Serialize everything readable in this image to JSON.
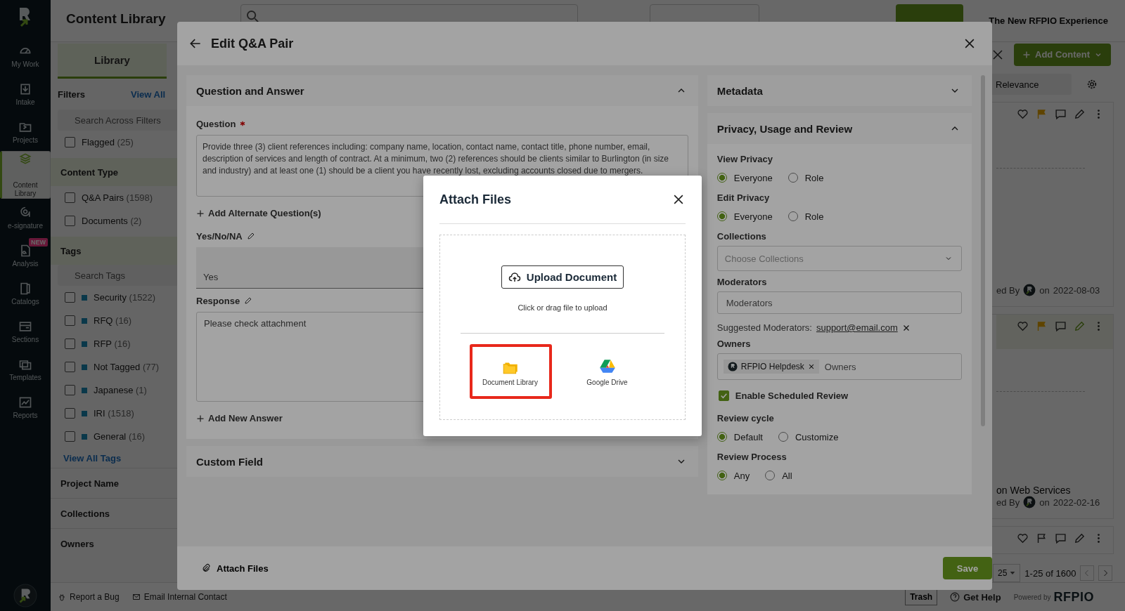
{
  "nav": {
    "items": [
      {
        "label": "My Work",
        "selected": false
      },
      {
        "label": "Intake",
        "selected": false
      },
      {
        "label": "Projects",
        "selected": false
      },
      {
        "label": "Content Library",
        "selected": true
      },
      {
        "label": "e-signature",
        "selected": false
      },
      {
        "label": "Analysis",
        "selected": false,
        "badge": "NEW"
      },
      {
        "label": "Catalogs",
        "selected": false
      },
      {
        "label": "Sections",
        "selected": false
      },
      {
        "label": "Templates",
        "selected": false
      },
      {
        "label": "Reports",
        "selected": false
      }
    ]
  },
  "page": {
    "title": "Content Library",
    "experience_menu": "The New RFPIO Experience",
    "add_content_button": "Add Content"
  },
  "filters": {
    "tab": "Library",
    "title": "Filters",
    "view_all": "View All",
    "search": {
      "placeholder": "Search Across Filters"
    },
    "flagged": {
      "label": "Flagged",
      "count": "(25)",
      "checked": false
    },
    "content_type": {
      "title": "Content Type",
      "items": [
        {
          "label": "Q&A Pairs",
          "count": "(1598)",
          "checked": false
        },
        {
          "label": "Documents",
          "count": "(2)",
          "checked": false
        }
      ]
    },
    "tags": {
      "title": "Tags",
      "search": {
        "placeholder": "Search Tags"
      },
      "items": [
        {
          "label": "Security",
          "count": "(1522)",
          "checked": false
        },
        {
          "label": "RFQ",
          "count": "(16)",
          "checked": false
        },
        {
          "label": "RFP",
          "count": "(16)",
          "checked": false
        },
        {
          "label": "Not Tagged",
          "count": "(77)",
          "checked": false
        },
        {
          "label": "Japanese",
          "count": "(1)",
          "checked": false
        },
        {
          "label": "IRI",
          "count": "(1518)",
          "checked": false
        },
        {
          "label": "General",
          "count": "(16)",
          "checked": false
        }
      ],
      "view_all": "View All Tags"
    },
    "collapsed_sections": [
      "Project Name",
      "Collections",
      "Owners"
    ]
  },
  "results": {
    "sort": "Relevance",
    "cards": [
      {
        "flagged": true,
        "highlighted": false,
        "author": "ed By",
        "on": "on",
        "date": "2022-08-03"
      },
      {
        "flagged": true,
        "highlighted": true,
        "snippet": "on Web Services",
        "author": "ed By",
        "on": "on",
        "date": "2022-02-16"
      },
      {
        "flagged": false,
        "highlighted": false
      }
    ],
    "page_size": "25",
    "range": "1-25 of 1600"
  },
  "footer": {
    "report_bug": "Report a Bug",
    "email_contact": "Email Internal Contact",
    "trash": "Trash",
    "get_help": "Get Help",
    "powered_by": "Powered by",
    "brand": "RFPIO"
  },
  "edit_dialog": {
    "title": "Edit Q&A Pair",
    "question_section": {
      "title": "Question and Answer",
      "expanded": true,
      "question_label": "Question",
      "required": true,
      "question": "Provide three (3) client references including: company name, location, contact name, contact title, phone number, email, description of services and length of contract. At a minimum, two (2) references should be clients similar to Burlington (in size and industry) and at least one (1) should be a client you have recently lost, excluding accounts closed due to mergers.",
      "add_alternate": "Add Alternate Question(s)",
      "yes_no_label": "Yes/No/NA",
      "yes_no_value": "Yes",
      "response_label": "Response",
      "response": "Please check attachment",
      "add_answer": "Add New Answer"
    },
    "custom_field": {
      "title": "Custom Field",
      "expanded": false
    },
    "metadata": {
      "title": "Metadata",
      "expanded": false
    },
    "privacy": {
      "title": "Privacy, Usage and Review",
      "expanded": true,
      "fields": [
        {
          "kind": "radio",
          "label": "View Privacy",
          "options": [
            {
              "label": "Everyone",
              "selected": true
            },
            {
              "label": "Role",
              "selected": false
            }
          ]
        },
        {
          "kind": "radio",
          "label": "Edit Privacy",
          "options": [
            {
              "label": "Everyone",
              "selected": true
            },
            {
              "label": "Role",
              "selected": false
            }
          ]
        },
        {
          "kind": "select",
          "label": "Collections",
          "placeholder": "Choose Collections"
        },
        {
          "kind": "input",
          "label": "Moderators",
          "placeholder": "Moderators"
        },
        {
          "kind": "suggestion",
          "label": "Suggested Moderators:",
          "link": "support@email.com"
        },
        {
          "kind": "owners",
          "label": "Owners",
          "chips": [
            "RFPIO Helpdesk"
          ],
          "placeholder": "Owners"
        },
        {
          "kind": "checkbox",
          "label": "Enable Scheduled Review",
          "checked": true
        },
        {
          "kind": "radio",
          "label": "Review cycle",
          "options": [
            {
              "label": "Default",
              "selected": true
            },
            {
              "label": "Customize",
              "selected": false
            }
          ]
        },
        {
          "kind": "radio",
          "label": "Review Process",
          "options": [
            {
              "label": "Any",
              "selected": true
            },
            {
              "label": "All",
              "selected": false
            }
          ]
        }
      ]
    },
    "attach_button": "Attach Files",
    "save_button": "Save"
  },
  "attach_dialog": {
    "title": "Attach Files",
    "upload_button": "Upload Document",
    "hint": "Click or drag file to upload",
    "sources": [
      {
        "label": "Document Library",
        "selected": true
      },
      {
        "label": "Google Drive",
        "selected": false
      }
    ]
  }
}
